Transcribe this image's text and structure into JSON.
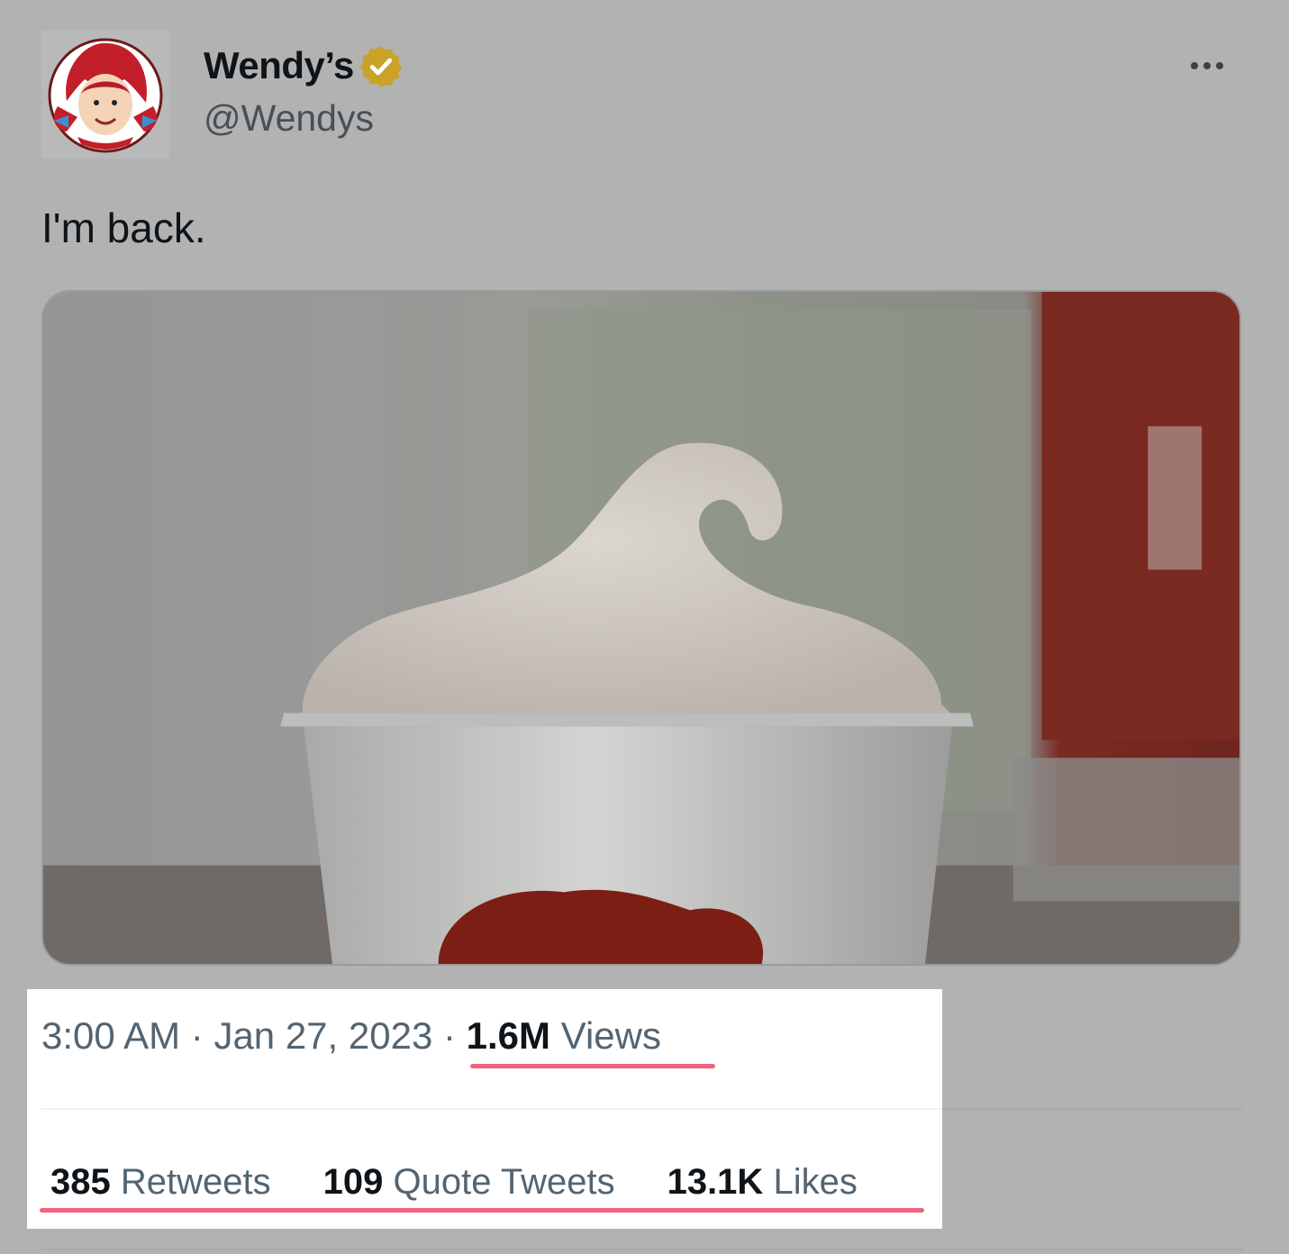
{
  "account": {
    "display_name": "Wendy’s",
    "handle": "@Wendys",
    "avatar_icon": "wendys-logo-icon",
    "verified_icon": "verified-badge-icon",
    "verified_color": "#c9a227"
  },
  "tweet": {
    "text": "I'm back.",
    "media_icon": "frosty-photo"
  },
  "meta": {
    "time": "3:00 AM",
    "separator": " · ",
    "date": "Jan 27, 2023",
    "views_count": "1.6M",
    "views_label": "Views"
  },
  "stats": {
    "retweets_count": "385",
    "retweets_label": "Retweets",
    "quotes_count": "109",
    "quotes_label": "Quote Tweets",
    "likes_count": "13.1K",
    "likes_label": "Likes"
  },
  "colors": {
    "highlight_underline": "#f0637f",
    "primary_text": "#0f1419",
    "secondary_text": "#536471"
  }
}
